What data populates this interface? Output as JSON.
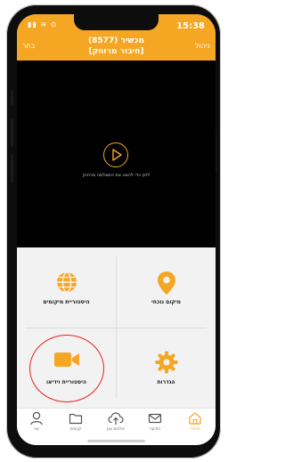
{
  "status": {
    "time": "15:38",
    "icons": "▮▮ ≋ ⊙"
  },
  "nav": {
    "left": "בחר",
    "right": "ניהול",
    "title_line1": "מכשיר (8577)",
    "title_line2": "[חיבור מרוחק]"
  },
  "video": {
    "caption": "לחץ כדי להציג את המצלמה מרחוק"
  },
  "tiles": [
    {
      "label": "היסטוריית מיקומים",
      "icon": "globe-icon"
    },
    {
      "label": "מיקום נוכחי",
      "icon": "location-pin-icon"
    },
    {
      "label": "היסטוריית וידיאו",
      "icon": "video-camera-icon"
    },
    {
      "label": "הגדרות",
      "icon": "gear-icon"
    }
  ],
  "tabs": [
    {
      "label": "אני",
      "icon": "person-icon"
    },
    {
      "label": "קבצים",
      "icon": "folder-icon"
    },
    {
      "label": "אלבום ענן",
      "icon": "cloud-upload-icon"
    },
    {
      "label": "הודעה",
      "icon": "envelope-icon"
    },
    {
      "label": "מכשיר",
      "icon": "home-icon"
    }
  ],
  "colors": {
    "accent": "#f5a623",
    "highlight_circle": "#e8231e",
    "video_bg": "#000000"
  }
}
